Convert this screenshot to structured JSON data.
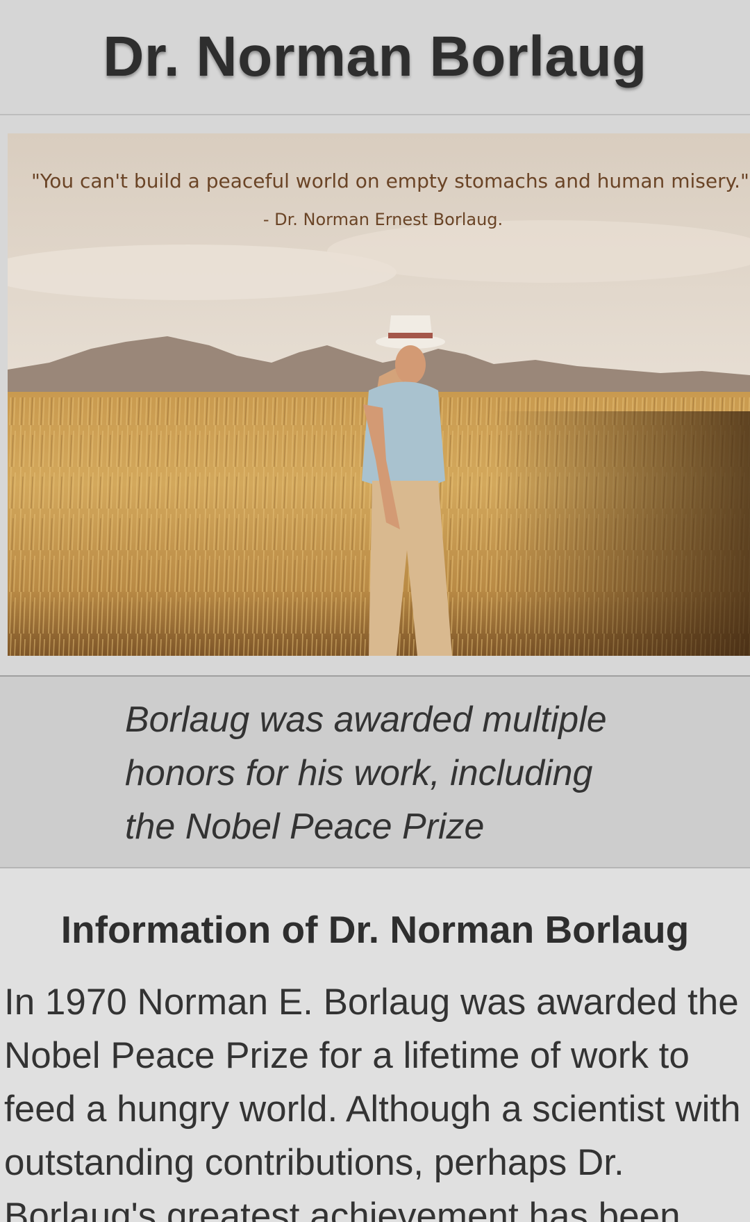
{
  "header": {
    "title": "Dr. Norman Borlaug"
  },
  "photo": {
    "quote": "\"You can't build a peaceful world on empty stomachs and human misery.\"",
    "quote_author": "- Dr. Norman Ernest Borlaug."
  },
  "caption": {
    "text": "Borlaug was awarded multiple honors for his work, including the Nobel Peace Prize"
  },
  "info": {
    "heading": "Information of Dr. Norman Borlaug",
    "body": "In 1970 Norman E. Borlaug was awarded the Nobel Peace Prize for a lifetime of work to feed a hungry world. Although a scientist with outstanding contributions, perhaps Dr. Borlaug's greatest achievement has been"
  }
}
